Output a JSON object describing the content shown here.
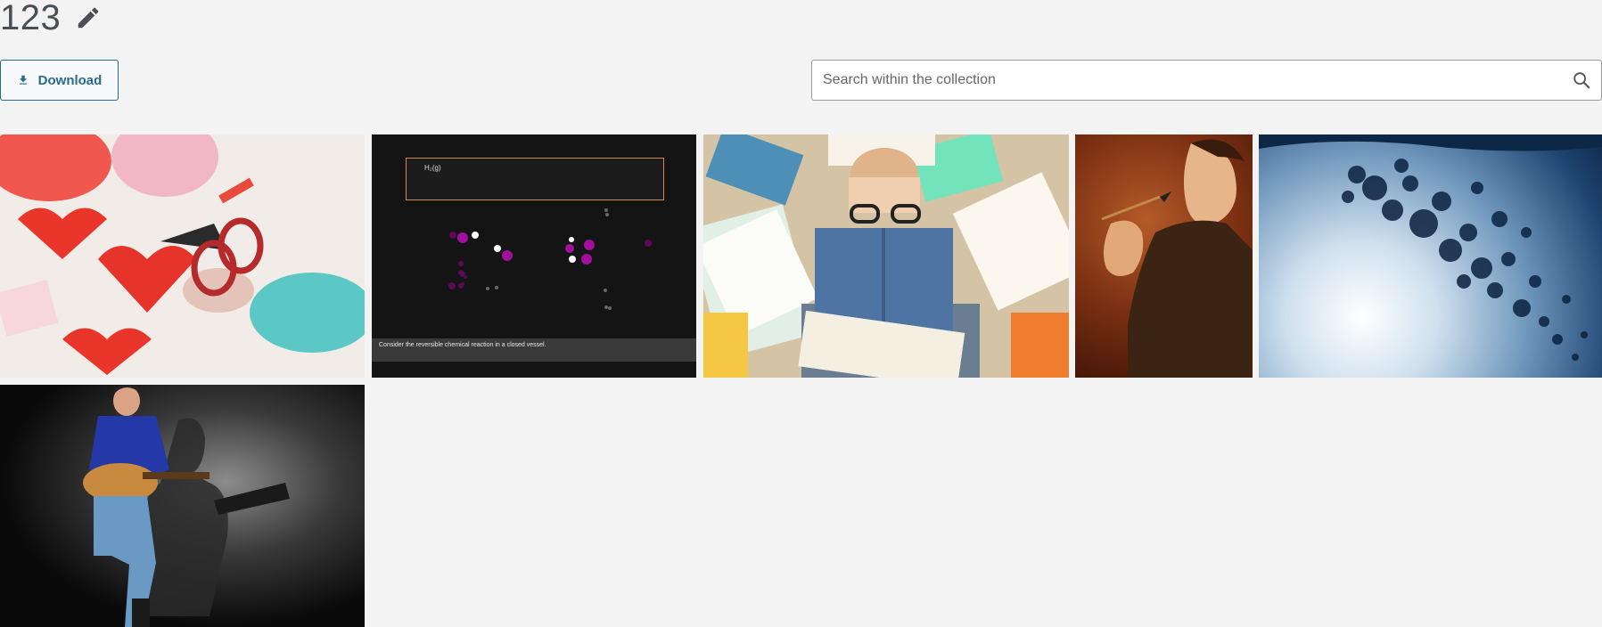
{
  "collection": {
    "title": "123",
    "edit_icon": "pencil-icon"
  },
  "toolbar": {
    "download_label": "Download",
    "download_icon": "download-icon"
  },
  "search": {
    "placeholder": "Search within the collection",
    "value": "",
    "icon": "search-icon"
  },
  "gallery": {
    "items": [
      {
        "kind": "image",
        "subject": "crafts-hearts"
      },
      {
        "kind": "video",
        "subject": "chemistry-animation",
        "formula_label": "H₂(g)",
        "caption": "Consider the reversible chemical reaction in a closed vessel."
      },
      {
        "kind": "image",
        "subject": "man-with-books"
      },
      {
        "kind": "image",
        "subject": "man-with-dart"
      },
      {
        "kind": "image",
        "subject": "water-bubbles"
      },
      {
        "kind": "image",
        "subject": "guitarist"
      }
    ]
  },
  "colors": {
    "accent": "#2a6b8a",
    "background": "#f3f3f3",
    "title": "#4a4f55"
  }
}
